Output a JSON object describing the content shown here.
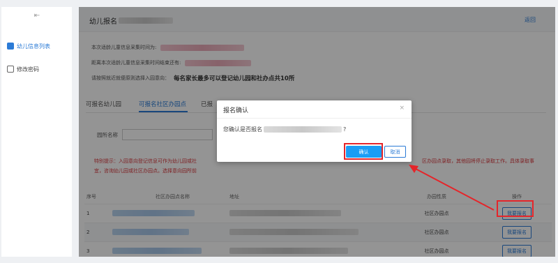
{
  "sidebar": {
    "items": [
      {
        "label": "幼儿信息列表",
        "icon": "user-card-icon"
      },
      {
        "label": "修改密码",
        "icon": "lock-icon"
      }
    ]
  },
  "header": {
    "title": "幼儿报名",
    "back": "返回"
  },
  "info": {
    "line1": "本次适龄儿童信息采集时间为:",
    "line2": "距离本次适龄儿童信息采集时间结束还有:",
    "line3_prefix": "请按照就近就便原则选择入园意向：",
    "line3_strong": "每名家长最多可以登记幼儿园和社办点共10所"
  },
  "tabs": [
    {
      "label": "可报名幼儿园"
    },
    {
      "label": "可报名社区办园点"
    },
    {
      "label": "已报"
    }
  ],
  "search": {
    "label": "园所名称"
  },
  "notice": {
    "left1": "特别提示：入园意向登记信息可作为幼儿园或社",
    "left2": "宜，咨询幼儿园或社区办园点。选择意向园所前",
    "right1": "区办园点录取，其他园将停止录取工作。具体录取事"
  },
  "table": {
    "headers": [
      "序号",
      "社区办园点名称",
      "地址",
      "办园性质",
      "操作"
    ],
    "rows": [
      {
        "no": "1",
        "type": "社区办园点",
        "op": "我要报名"
      },
      {
        "no": "2",
        "type": "社区办园点",
        "op": "我要报名"
      },
      {
        "no": "3",
        "type": "社区办园点",
        "op": "我要报名"
      }
    ]
  },
  "dialog": {
    "title": "报名确认",
    "close": "×",
    "msg_prefix": "您确认是否报名",
    "msg_suffix": "?",
    "ok": "确认",
    "cancel": "取消"
  },
  "colors": {
    "accent": "#2b7bd6",
    "highlight": "#e5252a",
    "primary_button": "#1a9df5"
  }
}
